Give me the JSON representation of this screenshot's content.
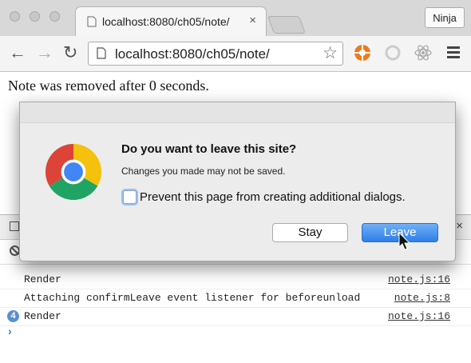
{
  "window": {
    "tab_title": "localhost:8080/ch05/note/",
    "tab_close": "×",
    "profile_label": "Ninja"
  },
  "toolbar": {
    "back": "←",
    "forward": "→",
    "reload": "↻",
    "url": "localhost:8080/ch05/note/",
    "bookmark_star": "☆"
  },
  "page": {
    "text": "Note was removed after 0 seconds."
  },
  "dialog": {
    "title": "Do you want to leave this site?",
    "message": "Changes you made may not be saved.",
    "checkbox_label": "Prevent this page from creating additional dialogs.",
    "checkbox_checked": false,
    "stay_label": "Stay",
    "leave_label": "Leave"
  },
  "devtools": {
    "close": "×",
    "rows": [
      {
        "badge": "",
        "message": "Render",
        "source": "note.js:16"
      },
      {
        "badge": "",
        "message": "Attaching confirmLeave event listener for beforeunload",
        "source": "note.js:8"
      },
      {
        "badge": "4",
        "message": "Render",
        "source": "note.js:16"
      }
    ],
    "prompt": "›"
  }
}
